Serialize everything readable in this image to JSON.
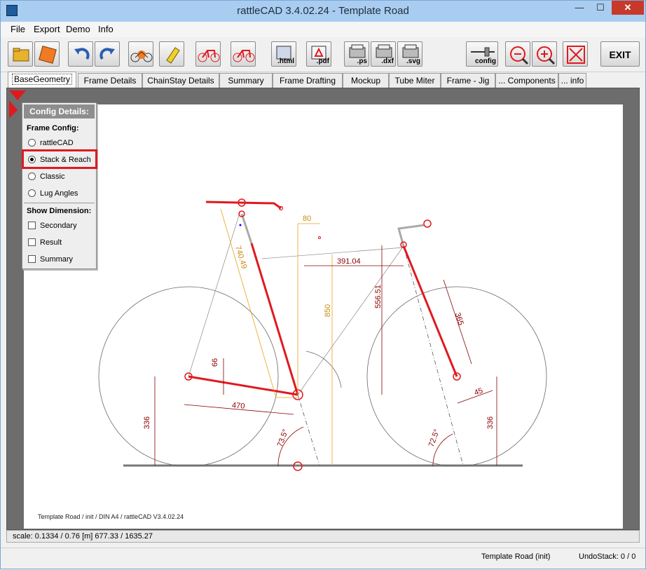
{
  "window": {
    "title": "rattleCAD  3.4.02.24 - Template Road"
  },
  "titlebar_controls": {
    "minimize": "—",
    "maximize": "☐",
    "close": "✕"
  },
  "menu": [
    {
      "label": "File"
    },
    {
      "label": "Export"
    },
    {
      "label": "Demo"
    },
    {
      "label": "Info"
    }
  ],
  "toolbar": {
    "buttons": [
      {
        "icon": "folder-open-icon",
        "label": ""
      },
      {
        "icon": "save-disk-icon",
        "label": ""
      },
      {
        "icon": "undo-icon",
        "label": ""
      },
      {
        "icon": "redo-icon",
        "label": ""
      },
      {
        "icon": "bike-render-icon",
        "label": ""
      },
      {
        "icon": "cleanup-icon",
        "label": ""
      },
      {
        "icon": "bike-red-icon",
        "label": ""
      },
      {
        "icon": "bike-red-icon-2",
        "label": ""
      },
      {
        "icon": "html-export-icon",
        "label": ".html"
      },
      {
        "icon": "pdf-export-icon",
        "label": ".pdf"
      },
      {
        "icon": "ps-export-icon",
        "label": ".ps"
      },
      {
        "icon": "dxf-export-icon",
        "label": ".dxf"
      },
      {
        "icon": "svg-export-icon",
        "label": ".svg"
      },
      {
        "icon": "config-icon",
        "label": "config"
      },
      {
        "icon": "zoom-out-icon",
        "label": ""
      },
      {
        "icon": "zoom-in-icon",
        "label": ""
      },
      {
        "icon": "fit-view-icon",
        "label": ""
      },
      {
        "icon": "exit-icon",
        "label": "EXIT"
      }
    ]
  },
  "tabs": [
    {
      "label": "BaseGeometry",
      "active": true
    },
    {
      "label": "Frame Details"
    },
    {
      "label": "ChainStay Details"
    },
    {
      "label": "Summary"
    },
    {
      "label": "Frame Drafting"
    },
    {
      "label": "Mockup"
    },
    {
      "label": "Tube Miter"
    },
    {
      "label": "Frame - Jig"
    },
    {
      "label": "... Components"
    },
    {
      "label": "... info"
    }
  ],
  "config_panel": {
    "title": "Config Details:",
    "frame_config_label": "Frame Config:",
    "frame_config_options": [
      {
        "label": "rattleCAD",
        "selected": false
      },
      {
        "label": "Stack & Reach",
        "selected": true
      },
      {
        "label": "Classic",
        "selected": false
      },
      {
        "label": "Lug Angles",
        "selected": false
      }
    ],
    "show_dimension_label": "Show Dimension:",
    "dimension_options": [
      {
        "label": "Secondary",
        "checked": false
      },
      {
        "label": "Result",
        "checked": false
      },
      {
        "label": "Summary",
        "checked": false
      }
    ]
  },
  "drawing": {
    "dimensions": {
      "top_offset": "80",
      "reach": "391.04",
      "stack": "556.51",
      "seat_length": "740.49",
      "saddle_height": "850",
      "fork_length": "365",
      "bb_drop": "66",
      "chainstay": "470",
      "rear_wheel_radius": "336",
      "front_wheel_radius": "336",
      "seat_angle": "73.5°",
      "head_angle": "72.5°",
      "fork_offset": "45"
    },
    "footer": "Template Road   /   init   /  DIN A4  /   rattleCAD   V3.4.02.24"
  },
  "status": {
    "scale": "scale: 0.1334 / 0.76  [m]  677.33 / 1635.27"
  },
  "bottom": {
    "project": "Template Road (init)",
    "undostack": "UndoStack:  0 / 0"
  },
  "colors": {
    "frame_red": "#e0191f",
    "dim_dark_red": "#8b0000",
    "dim_orange": "#e8a21a",
    "titlebar": "#a9cdf0"
  }
}
